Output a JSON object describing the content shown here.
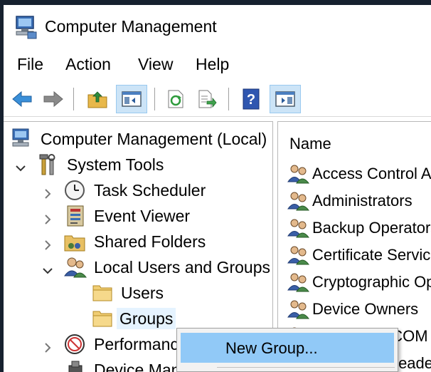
{
  "window": {
    "title": "Computer Management"
  },
  "menu": [
    "File",
    "Action",
    "View",
    "Help"
  ],
  "toolbar": {
    "buttons": [
      "back-arrow-icon",
      "forward-arrow-icon",
      "up-folder-icon",
      "show-hide-tree-icon",
      "refresh-icon",
      "export-list-icon",
      "help-icon",
      "show-hide-action-pane-icon"
    ]
  },
  "tree": {
    "items": [
      {
        "label": "Computer Management (Local)",
        "icon": "computer-management-icon"
      },
      {
        "label": "System Tools",
        "icon": "tools-icon"
      },
      {
        "label": "Task Scheduler",
        "icon": "clock-icon"
      },
      {
        "label": "Event Viewer",
        "icon": "event-viewer-icon"
      },
      {
        "label": "Shared Folders",
        "icon": "shared-folder-icon"
      },
      {
        "label": "Local Users and Groups",
        "icon": "users-icon"
      },
      {
        "label": "Users",
        "icon": "folder-icon"
      },
      {
        "label": "Groups",
        "icon": "folder-icon"
      },
      {
        "label": "Performance",
        "icon": "performance-icon"
      },
      {
        "label": "Device Manager",
        "icon": "device-manager-icon"
      }
    ]
  },
  "list": {
    "column_name": "Name",
    "rows": [
      "Access Control Assistance Operators",
      "Administrators",
      "Backup Operators",
      "Certificate Service DCOM Access",
      "Cryptographic Operators",
      "Device Owners",
      "Distributed COM Users",
      "Event Log Readers"
    ]
  },
  "context_menu": {
    "items": [
      "New Group..."
    ]
  },
  "colors": {
    "selection": "#e5f3ff",
    "menu_highlight": "#91c9f7",
    "frame": "#16212f"
  }
}
